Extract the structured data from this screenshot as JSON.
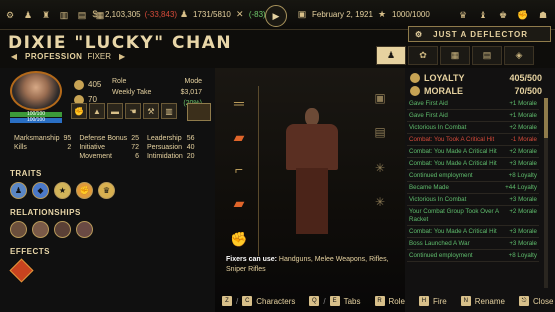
{
  "topbar": {
    "money": "2,103,305",
    "money_change": "(-33,843)",
    "population": "1731/5810",
    "population_change": "(-83)",
    "date": "February 2, 1921",
    "heat": "1000/1000"
  },
  "character": {
    "name": "DIXIE \"LUCKY\" CHAN",
    "profession_label": "PROFESSION",
    "profession": "FIXER",
    "title": "JUST A DEFLECTOR",
    "hp": "100/100",
    "armor": "100/100",
    "gold_stat": "405",
    "second_stat": "70",
    "role_label": "Role",
    "weekly_take_label": "Weekly Take",
    "mode_label": "Mode",
    "weekly_take_value": "$3,017",
    "weekly_take_pct": "(20%)"
  },
  "stats": [
    {
      "a": "Marksmanship",
      "av": "95",
      "b": "Defense Bonus",
      "bv": "25",
      "c": "Leadership",
      "cv": "56"
    },
    {
      "a": "Kills",
      "av": "2",
      "b": "Initiative",
      "bv": "72",
      "c": "Persuasion",
      "cv": "40"
    },
    {
      "a": "",
      "av": "",
      "b": "Movement",
      "bv": "6",
      "c": "Intimidation",
      "cv": "20"
    }
  ],
  "sections": {
    "traits": "TRAITS",
    "relationships": "RELATIONSHIPS",
    "effects": "EFFECTS"
  },
  "fixers": {
    "label": "Fixers can use:",
    "text": "Handguns, Melee Weapons, Rifles, Sniper Rifles"
  },
  "loyalty": {
    "label": "LOYALTY",
    "value": "405/500"
  },
  "morale": {
    "label": "MORALE",
    "value": "70/500"
  },
  "log": [
    {
      "t": "Gave First Aid",
      "v": "+1 Morale",
      "c": "ok"
    },
    {
      "t": "Gave First Aid",
      "v": "+1 Morale",
      "c": "ok"
    },
    {
      "t": "Victorious In Combat",
      "v": "+2 Morale",
      "c": "ok"
    },
    {
      "t": "Combat: You Took A Critical Hit",
      "v": "-1 Morale",
      "c": "bad"
    },
    {
      "t": "Combat: You Made A Critical Hit",
      "v": "+2 Morale",
      "c": "ok"
    },
    {
      "t": "Combat: You Made A Critical Hit",
      "v": "+3 Morale",
      "c": "ok"
    },
    {
      "t": "Continued employment",
      "v": "+8 Loyalty",
      "c": "ok"
    },
    {
      "t": "Became Made",
      "v": "+44 Loyalty",
      "c": "ok"
    },
    {
      "t": "Victorious In Combat",
      "v": "+3 Morale",
      "c": "ok"
    },
    {
      "t": "Your Combat Group Took Over A Racket",
      "v": "+2 Morale",
      "c": "ok"
    },
    {
      "t": "Combat: You Made A Critical Hit",
      "v": "+3 Morale",
      "c": "ok"
    },
    {
      "t": "Boss Launched A War",
      "v": "+3 Morale",
      "c": "ok"
    },
    {
      "t": "Continued employment",
      "v": "+8 Loyalty",
      "c": "ok"
    }
  ],
  "bottom": {
    "characters": "Characters",
    "tabs": "Tabs",
    "role": "Role",
    "fire": "Fire",
    "rename": "Rename",
    "close": "Close"
  }
}
